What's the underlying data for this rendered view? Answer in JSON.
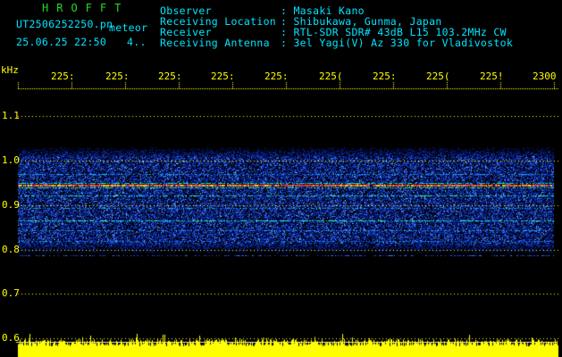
{
  "brand": "HROFFT",
  "file_name": "UT2506252250.pn",
  "mode_label": "meteor",
  "datetime": "25.06.25 22:50",
  "count": "4..",
  "header_labels": [
    "Observer",
    "Receiving Location",
    "Receiver",
    "Receiving Antenna"
  ],
  "header_values": [
    ": Masaki Kano",
    ": Shibukawa, Gunma, Japan",
    ": RTL-SDR SDR# 43dB L15 103.2MHz CW",
    ": 3el Yagi(V) Az 330 for Vladivostok"
  ],
  "y_unit": "kHz",
  "y_ticks": [
    "1.1",
    "1.0",
    "0.9",
    "0.8",
    "0.7",
    "0.6"
  ],
  "x_ticks": [
    "225:",
    "225:",
    "225:",
    "225:",
    "225:",
    "225(",
    "225:",
    "225(",
    "225!",
    "2300"
  ],
  "colors": {
    "header_text": "#00e5ff",
    "axis": "#ffff00",
    "brand": "#22dd22",
    "amplitude": "#ffff00"
  }
}
